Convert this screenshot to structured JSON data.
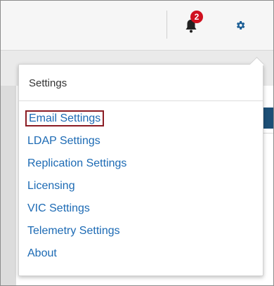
{
  "header": {
    "notifications": {
      "count": "2",
      "icon": "bell-icon"
    },
    "settings_icon": "gear-icon"
  },
  "dropdown": {
    "title": "Settings",
    "items": [
      {
        "label": "Email Settings",
        "highlighted": true
      },
      {
        "label": "LDAP Settings"
      },
      {
        "label": "Replication Settings"
      },
      {
        "label": "Licensing"
      },
      {
        "label": "VIC Settings"
      },
      {
        "label": "Telemetry Settings"
      },
      {
        "label": "About"
      }
    ]
  },
  "colors": {
    "link": "#1c6ab4",
    "badge": "#d0101f",
    "highlight_box": "#8b1c24",
    "accent_bar": "#1d4f76"
  }
}
